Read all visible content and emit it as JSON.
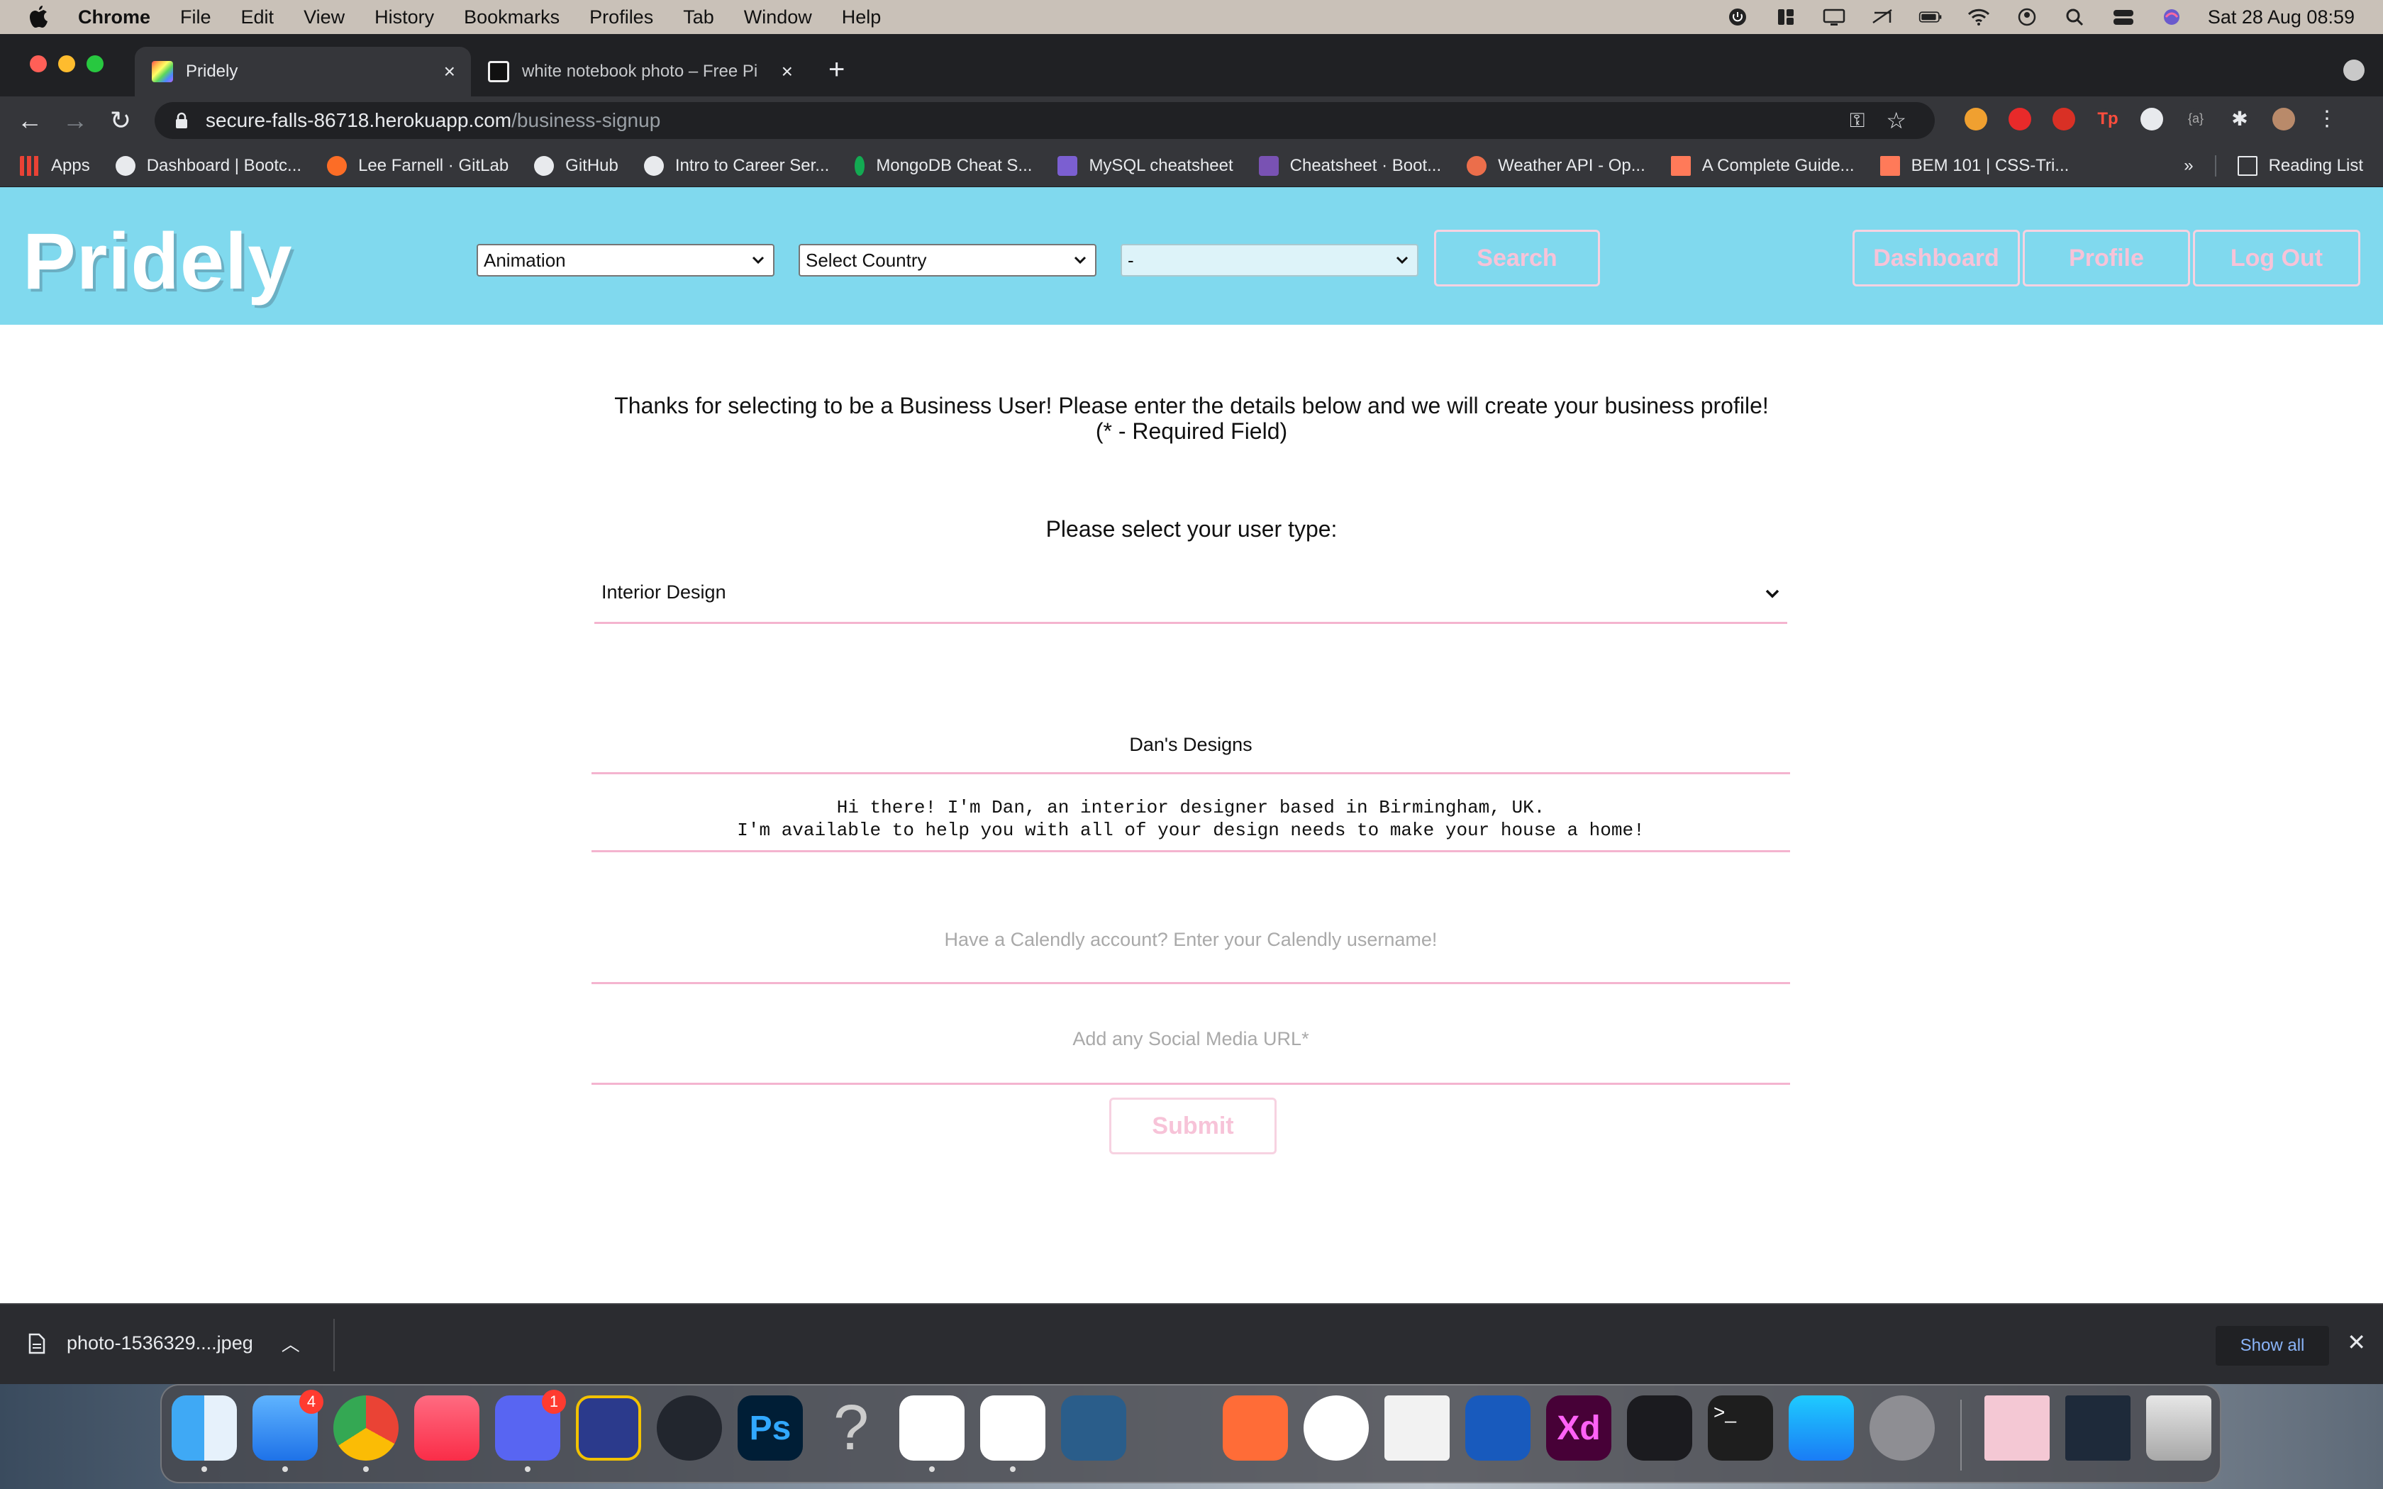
{
  "menubar": {
    "app": "Chrome",
    "items": [
      "File",
      "Edit",
      "View",
      "History",
      "Bookmarks",
      "Profiles",
      "Tab",
      "Window",
      "Help"
    ],
    "datetime": "Sat 28 Aug  08:59"
  },
  "tabs": [
    {
      "title": "Pridely",
      "active": true
    },
    {
      "title": "white notebook photo – Free Pi",
      "active": false
    }
  ],
  "toolbar": {
    "url_host": "secure-falls-86718.herokuapp.com",
    "url_path": "/business-signup"
  },
  "bookmarks": {
    "items": [
      "Apps",
      "Dashboard | Bootc...",
      "Lee Farnell · GitLab",
      "GitHub",
      "Intro to Career Ser...",
      "MongoDB Cheat S...",
      "MySQL cheatsheet",
      "Cheatsheet · Boot...",
      "Weather API - Op...",
      "A Complete Guide...",
      "BEM 101 | CSS-Tri..."
    ],
    "overflow": "»",
    "reading_list": "Reading List"
  },
  "site": {
    "logo": "Pridely",
    "filters": {
      "category": "Animation",
      "country": "Select Country",
      "region": "-"
    },
    "search_label": "Search",
    "nav": [
      "Dashboard",
      "Profile",
      "Log Out"
    ]
  },
  "form": {
    "intro_line1": "Thanks for selecting to be a Business User! Please enter the details below and we will create your business profile!",
    "intro_line2": "(* - Required Field)",
    "usertype_label": "Please select your user type:",
    "usertype_value": "Interior Design",
    "business_name": "Dan's Designs",
    "bio_line1": "Hi there! I'm Dan, an interior designer based in Birmingham, UK.",
    "bio_line2": "I'm available to help you with all of your design needs to make your house a home!",
    "calendly_placeholder": "Have a Calendly account? Enter your Calendly username!",
    "social_placeholder": "Add any Social Media URL*",
    "submit_label": "Submit"
  },
  "downloads": {
    "file": "photo-1536329....jpeg",
    "show_all": "Show all"
  },
  "dock": {
    "mail_badge": "4",
    "discord_badge": "1"
  },
  "colors": {
    "header_bg": "#80d9ee",
    "accent_pink": "#f4b4cf"
  }
}
